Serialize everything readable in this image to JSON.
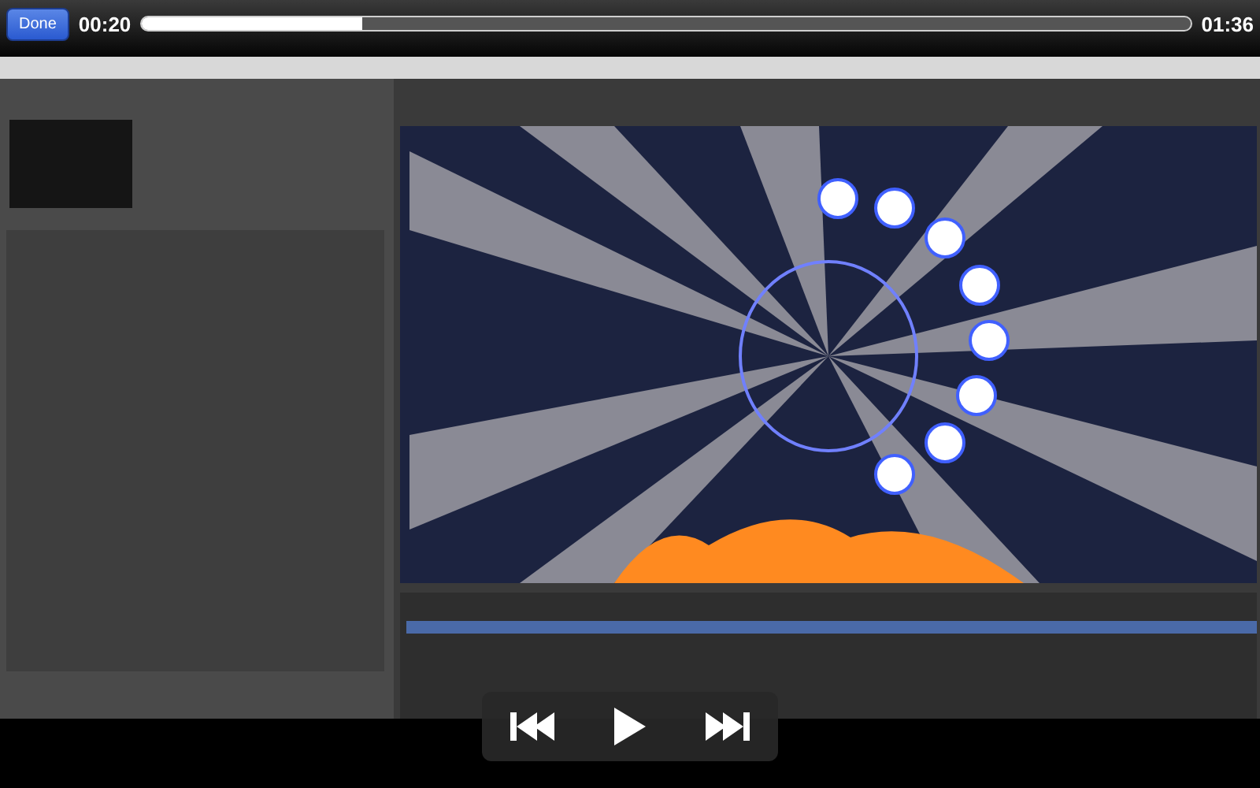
{
  "top_bar": {
    "done_button": "Done",
    "elapsed": "00:20",
    "remaining": "01:36",
    "progress": {
      "level": 0.21
    }
  },
  "controls": {
    "playing": false
  }
}
